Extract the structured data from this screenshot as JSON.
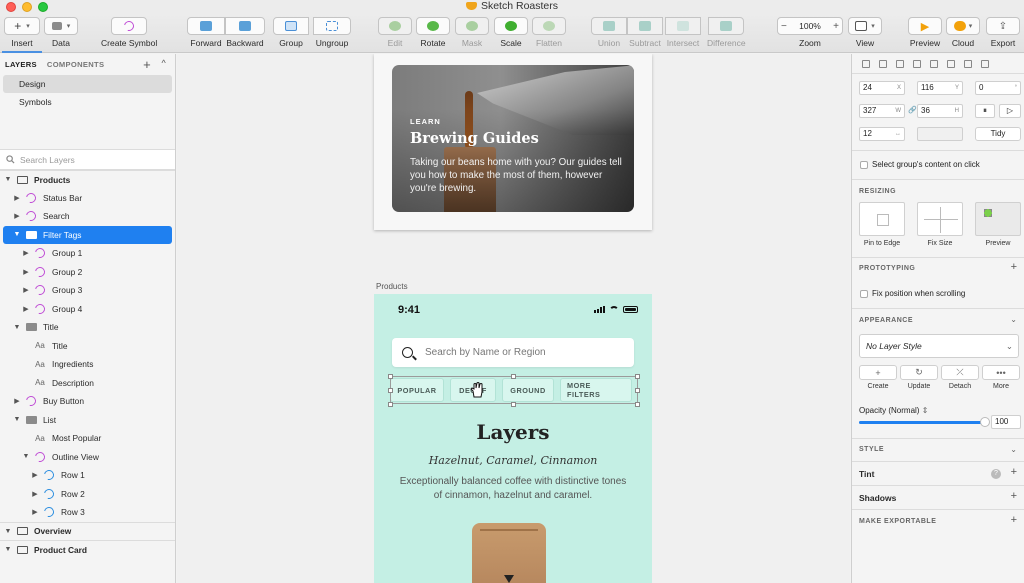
{
  "window": {
    "title": "Sketch Roasters"
  },
  "toolbar": {
    "insert": "Insert",
    "data": "Data",
    "create_symbol": "Create Symbol",
    "forward": "Forward",
    "backward": "Backward",
    "group": "Group",
    "ungroup": "Ungroup",
    "edit": "Edit",
    "rotate": "Rotate",
    "mask": "Mask",
    "scale": "Scale",
    "flatten": "Flatten",
    "union": "Union",
    "subtract": "Subtract",
    "intersect": "Intersect",
    "difference": "Difference",
    "zoom_label": "Zoom",
    "zoom_value": "100%",
    "zoom_minus": "−",
    "zoom_plus": "+",
    "view": "View",
    "preview": "Preview",
    "cloud": "Cloud",
    "export": "Export",
    "accent": "#4a90e2"
  },
  "left_panel": {
    "tabs": {
      "layers": "LAYERS",
      "components": "COMPONENTS",
      "add": "+",
      "collapse": "^"
    },
    "pages": [
      "Design",
      "Symbols"
    ],
    "search_placeholder": "Search Layers",
    "layers": [
      {
        "label": "Products",
        "type": "artboard",
        "indent": 0,
        "arrow": "down",
        "bold": true,
        "top": true
      },
      {
        "label": "Status Bar",
        "type": "symbol",
        "indent": 1,
        "arrow": "right"
      },
      {
        "label": "Search",
        "type": "symbol",
        "indent": 1,
        "arrow": "right"
      },
      {
        "label": "Filter Tags",
        "type": "folder",
        "indent": 1,
        "arrow": "down",
        "selected": true
      },
      {
        "label": "Group 1",
        "type": "symbol",
        "indent": 2,
        "arrow": "right"
      },
      {
        "label": "Group 2",
        "type": "symbol",
        "indent": 2,
        "arrow": "right"
      },
      {
        "label": "Group 3",
        "type": "symbol",
        "indent": 2,
        "arrow": "right"
      },
      {
        "label": "Group 4",
        "type": "symbol",
        "indent": 2,
        "arrow": "right"
      },
      {
        "label": "Title",
        "type": "folder",
        "indent": 1,
        "arrow": "down"
      },
      {
        "label": "Title",
        "type": "text",
        "indent": 2,
        "arrow": ""
      },
      {
        "label": "Ingredients",
        "type": "text",
        "indent": 2,
        "arrow": ""
      },
      {
        "label": "Description",
        "type": "text",
        "indent": 2,
        "arrow": ""
      },
      {
        "label": "Buy Button",
        "type": "symbol",
        "indent": 1,
        "arrow": "right"
      },
      {
        "label": "List",
        "type": "folder",
        "indent": 1,
        "arrow": "down"
      },
      {
        "label": "Most Popular",
        "type": "text",
        "indent": 2,
        "arrow": ""
      },
      {
        "label": "Outline View",
        "type": "symbol",
        "indent": 2,
        "arrow": "down"
      },
      {
        "label": "Row 1",
        "type": "symbol-blue",
        "indent": 3,
        "arrow": "right"
      },
      {
        "label": "Row 2",
        "type": "symbol-blue",
        "indent": 3,
        "arrow": "right"
      },
      {
        "label": "Row 3",
        "type": "symbol-blue",
        "indent": 3,
        "arrow": "right"
      },
      {
        "label": "Overview",
        "type": "artboard",
        "indent": 0,
        "arrow": "down",
        "bold": true,
        "top": true
      },
      {
        "label": "Product Card",
        "type": "artboard",
        "indent": 0,
        "arrow": "down",
        "bold": true,
        "top": true
      }
    ],
    "aa": "Aa"
  },
  "canvas": {
    "learn_card": {
      "eyebrow": "LEARN",
      "title": "Brewing Guides",
      "body": "Taking our beans home with you? Our guides tell you how to make the most of them, however you're brewing."
    },
    "artboard_label": "Products",
    "phone": {
      "time": "9:41",
      "search_placeholder": "Search by Name or Region",
      "filter_tags": [
        "POPULAR",
        "DECAF",
        "GROUND",
        "MORE FILTERS"
      ],
      "product_name": "Layers",
      "product_notes": "Hazelnut, Caramel, Cinnamon",
      "product_desc": "Exceptionally balanced coffee with distinctive tones of cinnamon, hazelnut and caramel.",
      "background": "#c4efe4"
    }
  },
  "inspector": {
    "x": "24",
    "x_suffix": "X",
    "y": "116",
    "y_suffix": "Y",
    "rotation": "0",
    "rotation_suffix": "°",
    "width": "327",
    "width_suffix": "W",
    "height": "36",
    "height_suffix": "H",
    "spacing": "12",
    "spacing_suffix": "↔",
    "tidy": "Tidy",
    "select_group_content": "Select group's content on click",
    "resizing": "RESIZING",
    "pin_to_edge": "Pin to Edge",
    "fix_size": "Fix Size",
    "preview": "Preview",
    "prototyping": "PROTOTYPING",
    "fix_position": "Fix position when scrolling",
    "appearance": "APPEARANCE",
    "layer_style": "No Layer Style",
    "create": "Create",
    "update": "Update",
    "detach": "Detach",
    "more": "More",
    "opacity_label": "Opacity (Normal)",
    "opacity_value": "100",
    "opacity_level": 1.0,
    "style": "STYLE",
    "tint": "Tint",
    "shadows": "Shadows",
    "make_exportable": "MAKE EXPORTABLE",
    "help": "?",
    "plus": "+"
  }
}
